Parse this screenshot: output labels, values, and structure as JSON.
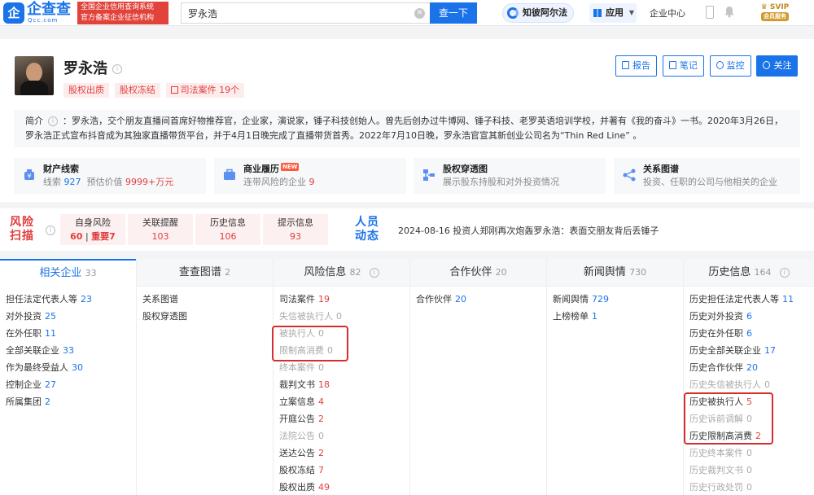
{
  "topbar": {
    "logo_mark": "企",
    "logo_text": "企查查",
    "logo_sub": "Qcc.com",
    "slogan_line1": "全国企业信用查询系统",
    "slogan_line2": "官方备案企业征信机构",
    "search_value": "罗永浩",
    "search_button": "查一下",
    "ai_label": "知彼阿尔法",
    "app_label": "应用",
    "enterprise_center": "企业中心",
    "svip_label": "SVIP",
    "svip_sub": "会员服务"
  },
  "profile": {
    "name": "罗永浩",
    "tags": [
      "股权出质",
      "股权冻结"
    ],
    "judicial_tag": "司法案件 19个",
    "actions": [
      "报告",
      "笔记",
      "监控",
      "关注"
    ],
    "bio_label": "简介",
    "bio_text": "罗永浩，交个朋友直播间首席好物推荐官，企业家，演说家，锤子科技创始人。曾先后创办过牛博网、锤子科技、老罗英语培训学校，并著有《我的奋斗》一书。2020年3月26日，罗永浩正式宣布抖音成为其独家直播带货平台，并于4月1日晚完成了直播带货首秀。2022年7月10日晚，罗永浩官宣其新创业公司名为“Thin Red Line” 。"
  },
  "cards": [
    {
      "title": "财产线索",
      "sub_prefix": "线索",
      "sub_num1": "927",
      "sub_mid": "预估价值",
      "sub_num2": "9999+万元"
    },
    {
      "title": "商业履历",
      "badge": "NEW",
      "sub_prefix": "连带风险的企业",
      "sub_num1": "9"
    },
    {
      "title": "股权穿透图",
      "sub_prefix": "展示股东持股和对外投资情况"
    },
    {
      "title": "关系图谱",
      "sub_prefix": "投资、任职的公司与他相关的企业"
    }
  ],
  "risk": {
    "title_line1": "风险",
    "title_line2": "扫描",
    "cells": [
      {
        "label": "自身风险",
        "num": "60",
        "extra": "重要7"
      },
      {
        "label": "关联提醒",
        "num": "103"
      },
      {
        "label": "历史信息",
        "num": "106"
      },
      {
        "label": "提示信息",
        "num": "93"
      }
    ],
    "people_line1": "人员",
    "people_line2": "动态",
    "news": "2024-08-16 投资人郑刚再次炮轰罗永浩：表面交朋友背后丢锤子"
  },
  "columns": [
    {
      "title": "相关企业",
      "count": "33",
      "active": true,
      "items": [
        {
          "label": "担任法定代表人等",
          "value": "23"
        },
        {
          "label": "对外投资",
          "value": "25"
        },
        {
          "label": "在外任职",
          "value": "11"
        },
        {
          "label": "全部关联企业",
          "value": "33"
        },
        {
          "label": "作为最终受益人",
          "value": "30"
        },
        {
          "label": "控制企业",
          "value": "27"
        },
        {
          "label": "所属集团",
          "value": "2"
        }
      ]
    },
    {
      "title": "查查图谱",
      "count": "2",
      "items": [
        {
          "label": "关系图谱"
        },
        {
          "label": "股权穿透图"
        }
      ]
    },
    {
      "title": "风险信息",
      "count": "82",
      "info": true,
      "items": [
        {
          "label": "司法案件",
          "value": "19",
          "red": true
        },
        {
          "label": "失信被执行人",
          "value": "0",
          "dim": true
        },
        {
          "label": "被执行人",
          "value": "0",
          "dim": true
        },
        {
          "label": "限制高消费",
          "value": "0",
          "dim": true
        },
        {
          "label": "终本案件",
          "value": "0",
          "dim": true
        },
        {
          "label": "裁判文书",
          "value": "18",
          "red": true
        },
        {
          "label": "立案信息",
          "value": "4",
          "red": true
        },
        {
          "label": "开庭公告",
          "value": "2",
          "red": true
        },
        {
          "label": "法院公告",
          "value": "0",
          "dim": true
        },
        {
          "label": "送达公告",
          "value": "2",
          "red": true
        },
        {
          "label": "股权冻结",
          "value": "7",
          "red": true
        },
        {
          "label": "股权出质",
          "value": "49",
          "red": true
        }
      ]
    },
    {
      "title": "合作伙伴",
      "count": "20",
      "items": [
        {
          "label": "合作伙伴",
          "value": "20"
        }
      ]
    },
    {
      "title": "新闻舆情",
      "count": "730",
      "items": [
        {
          "label": "新闻舆情",
          "value": "729"
        },
        {
          "label": "上榜榜单",
          "value": "1"
        }
      ]
    },
    {
      "title": "历史信息",
      "count": "164",
      "info": true,
      "items": [
        {
          "label": "历史担任法定代表人等",
          "value": "11"
        },
        {
          "label": "历史对外投资",
          "value": "6"
        },
        {
          "label": "历史在外任职",
          "value": "6"
        },
        {
          "label": "历史全部关联企业",
          "value": "17"
        },
        {
          "label": "历史合作伙伴",
          "value": "20"
        },
        {
          "label": "历史失信被执行人",
          "value": "0",
          "dim": true
        },
        {
          "label": "历史被执行人",
          "value": "5",
          "red": true
        },
        {
          "label": "历史诉前调解",
          "value": "0",
          "dim": true
        },
        {
          "label": "历史限制高消费",
          "value": "2",
          "red": true
        },
        {
          "label": "历史终本案件",
          "value": "0",
          "dim": true
        },
        {
          "label": "历史裁判文书",
          "value": "0",
          "dim": true
        },
        {
          "label": "历史行政处罚",
          "value": "0",
          "dim": true
        }
      ]
    }
  ]
}
